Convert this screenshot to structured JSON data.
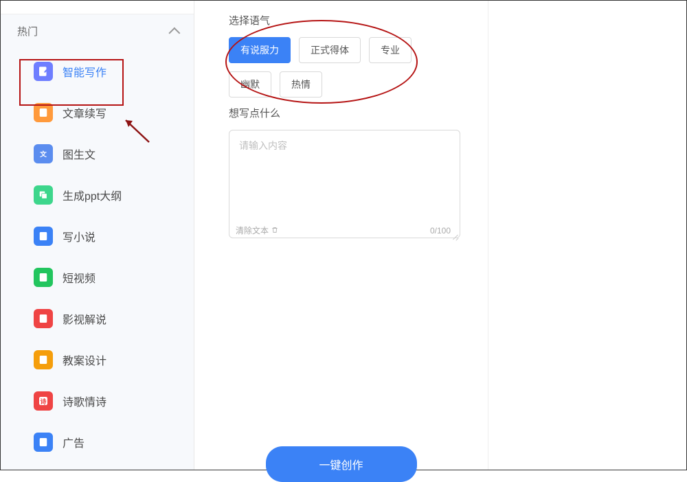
{
  "sidebar": {
    "section_label": "热门",
    "items": [
      {
        "label": "智能写作",
        "icon": "doc-edit",
        "color": "ic-blue1",
        "active": true
      },
      {
        "label": "文章续写",
        "icon": "doc-lines",
        "color": "ic-orange"
      },
      {
        "label": "图生文",
        "icon": "translate",
        "color": "ic-blue2"
      },
      {
        "label": "生成ppt大纲",
        "icon": "layers",
        "color": "ic-green"
      },
      {
        "label": "写小说",
        "icon": "doc-lines",
        "color": "ic-blue3"
      },
      {
        "label": "短视频",
        "icon": "doc-play",
        "color": "ic-green2"
      },
      {
        "label": "影视解说",
        "icon": "doc-play",
        "color": "ic-red"
      },
      {
        "label": "教案设计",
        "icon": "doc-lines",
        "color": "ic-orange2"
      },
      {
        "label": "诗歌情诗",
        "icon": "doc-char",
        "color": "ic-red2"
      },
      {
        "label": "广告",
        "icon": "doc-lines",
        "color": "ic-blue4"
      }
    ]
  },
  "form": {
    "tone_label": "选择语气",
    "tones": [
      {
        "label": "有说服力",
        "active": true
      },
      {
        "label": "正式得体"
      },
      {
        "label": "专业"
      },
      {
        "label": "幽默"
      },
      {
        "label": "热情"
      }
    ],
    "content_label": "想写点什么",
    "textarea_placeholder": "请输入内容",
    "clear_label": "清除文本",
    "char_count": "0/100",
    "submit_label": "一键创作"
  }
}
